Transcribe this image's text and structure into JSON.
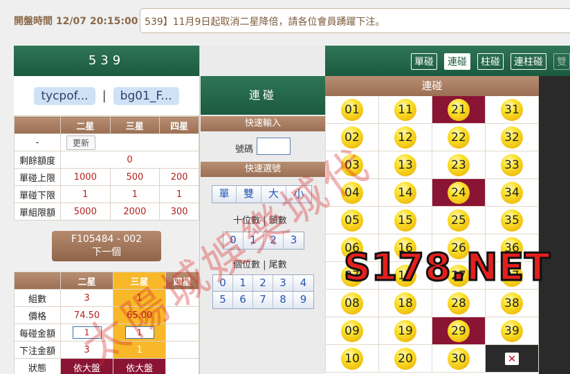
{
  "header": {
    "open_time_label": "開盤時間 12/07 20:15:00",
    "marquee": "539】11月9日起取消二星降倍，請各位會員踴躍下注。"
  },
  "left": {
    "title": "539",
    "accounts": [
      "tycpof...",
      "bg01_F..."
    ],
    "separator": "|",
    "limits": {
      "columns": [
        "二星",
        "三星",
        "四星"
      ],
      "dash": "-",
      "refresh_label": "更新",
      "rows": [
        {
          "label": "剩餘額度",
          "values": [
            "0"
          ]
        },
        {
          "label": "單碰上限",
          "values": [
            "1000",
            "500",
            "200"
          ]
        },
        {
          "label": "單碰下限",
          "values": [
            "1",
            "1",
            "1"
          ]
        },
        {
          "label": "單組限額",
          "values": [
            "5000",
            "2000",
            "300"
          ]
        }
      ]
    },
    "next_button": {
      "line1": "F105484 - 002",
      "line2": "下一個"
    },
    "bet": {
      "columns": [
        "二星",
        "三星",
        "四星"
      ],
      "rows": [
        {
          "label": "組數",
          "values": [
            "3",
            "1",
            ""
          ]
        },
        {
          "label": "價格",
          "values": [
            "74.50",
            "65.00",
            ""
          ]
        },
        {
          "label": "每碰金額",
          "values": [
            "1",
            "1",
            ""
          ]
        },
        {
          "label": "下注金額",
          "values": [
            "3",
            "1",
            ""
          ]
        },
        {
          "label": "狀態",
          "values": [
            "依大盤",
            "依大盤",
            ""
          ]
        }
      ]
    }
  },
  "tabs": [
    {
      "label": "單碰",
      "active": false
    },
    {
      "label": "連碰",
      "active": true
    },
    {
      "label": "柱碰",
      "active": false
    },
    {
      "label": "連柱碰",
      "active": false
    },
    {
      "label": "雙",
      "active": false
    }
  ],
  "middle": {
    "title": "連碰",
    "quick_input_head": "快速輸入",
    "code_label": "號碼",
    "quick_select_head": "快速選號",
    "type_buttons": [
      "單",
      "雙",
      "大",
      "小"
    ],
    "tens_label": "十位數 | 頭數",
    "tens_buttons": [
      "0",
      "1",
      "2",
      "3"
    ],
    "units_label": "個位數 | 尾數",
    "units_buttons_row1": [
      "0",
      "1",
      "2",
      "3",
      "4"
    ],
    "units_buttons_row2": [
      "5",
      "6",
      "7",
      "8",
      "9"
    ]
  },
  "number_grid": {
    "title": "連碰",
    "numbers": [
      "01",
      "11",
      "21",
      "31",
      "02",
      "12",
      "22",
      "32",
      "03",
      "13",
      "23",
      "33",
      "04",
      "14",
      "24",
      "34",
      "05",
      "15",
      "25",
      "35",
      "06",
      "16",
      "26",
      "36",
      "07",
      "17",
      "27",
      "37",
      "08",
      "18",
      "28",
      "38",
      "09",
      "19",
      "29",
      "39",
      "10",
      "20",
      "30"
    ],
    "selected": [
      "21",
      "24",
      "29"
    ],
    "close_icon": "close-icon"
  },
  "watermarks": {
    "text": "太陽城娛樂城代",
    "logo": "S178.NET"
  }
}
